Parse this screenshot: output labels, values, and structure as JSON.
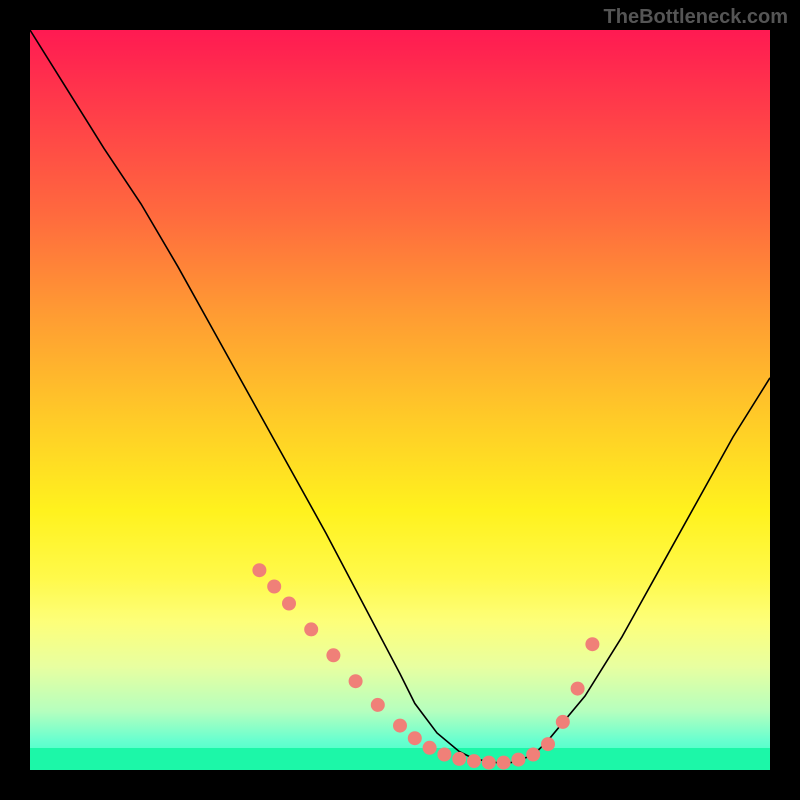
{
  "watermark": "TheBottleneck.com",
  "chart_data": {
    "type": "line",
    "title": "",
    "xlabel": "",
    "ylabel": "",
    "xlim": [
      0,
      100
    ],
    "ylim": [
      0,
      100
    ],
    "series": [
      {
        "name": "curve",
        "x": [
          0,
          5,
          10,
          15,
          20,
          25,
          30,
          35,
          40,
          45,
          50,
          52,
          55,
          58,
          60,
          63,
          65,
          68,
          70,
          75,
          80,
          85,
          90,
          95,
          100
        ],
        "y": [
          100,
          92,
          84,
          76.5,
          68,
          59,
          50,
          41,
          32,
          22.5,
          13,
          9,
          5,
          2.5,
          1.5,
          1,
          1,
          2,
          4,
          10,
          18,
          27,
          36,
          45,
          53
        ]
      }
    ],
    "markers": {
      "name": "salmon-dots",
      "color": "#f08078",
      "points_x": [
        31,
        33,
        35,
        38,
        41,
        44,
        47,
        50,
        52,
        54,
        56,
        58,
        60,
        62,
        64,
        66,
        68,
        70,
        72,
        74,
        76
      ],
      "points_y": [
        27,
        24.8,
        22.5,
        19,
        15.5,
        12,
        8.8,
        6,
        4.3,
        3,
        2.1,
        1.5,
        1.2,
        1,
        1,
        1.4,
        2.1,
        3.5,
        6.5,
        11,
        17
      ]
    },
    "gradient_stops": [
      {
        "pos": 0.0,
        "color": "#ff1a52"
      },
      {
        "pos": 0.25,
        "color": "#ff6a3e"
      },
      {
        "pos": 0.52,
        "color": "#ffc928"
      },
      {
        "pos": 0.74,
        "color": "#fff94a"
      },
      {
        "pos": 0.92,
        "color": "#b6ffbe"
      },
      {
        "pos": 1.0,
        "color": "#2effc4"
      }
    ]
  }
}
